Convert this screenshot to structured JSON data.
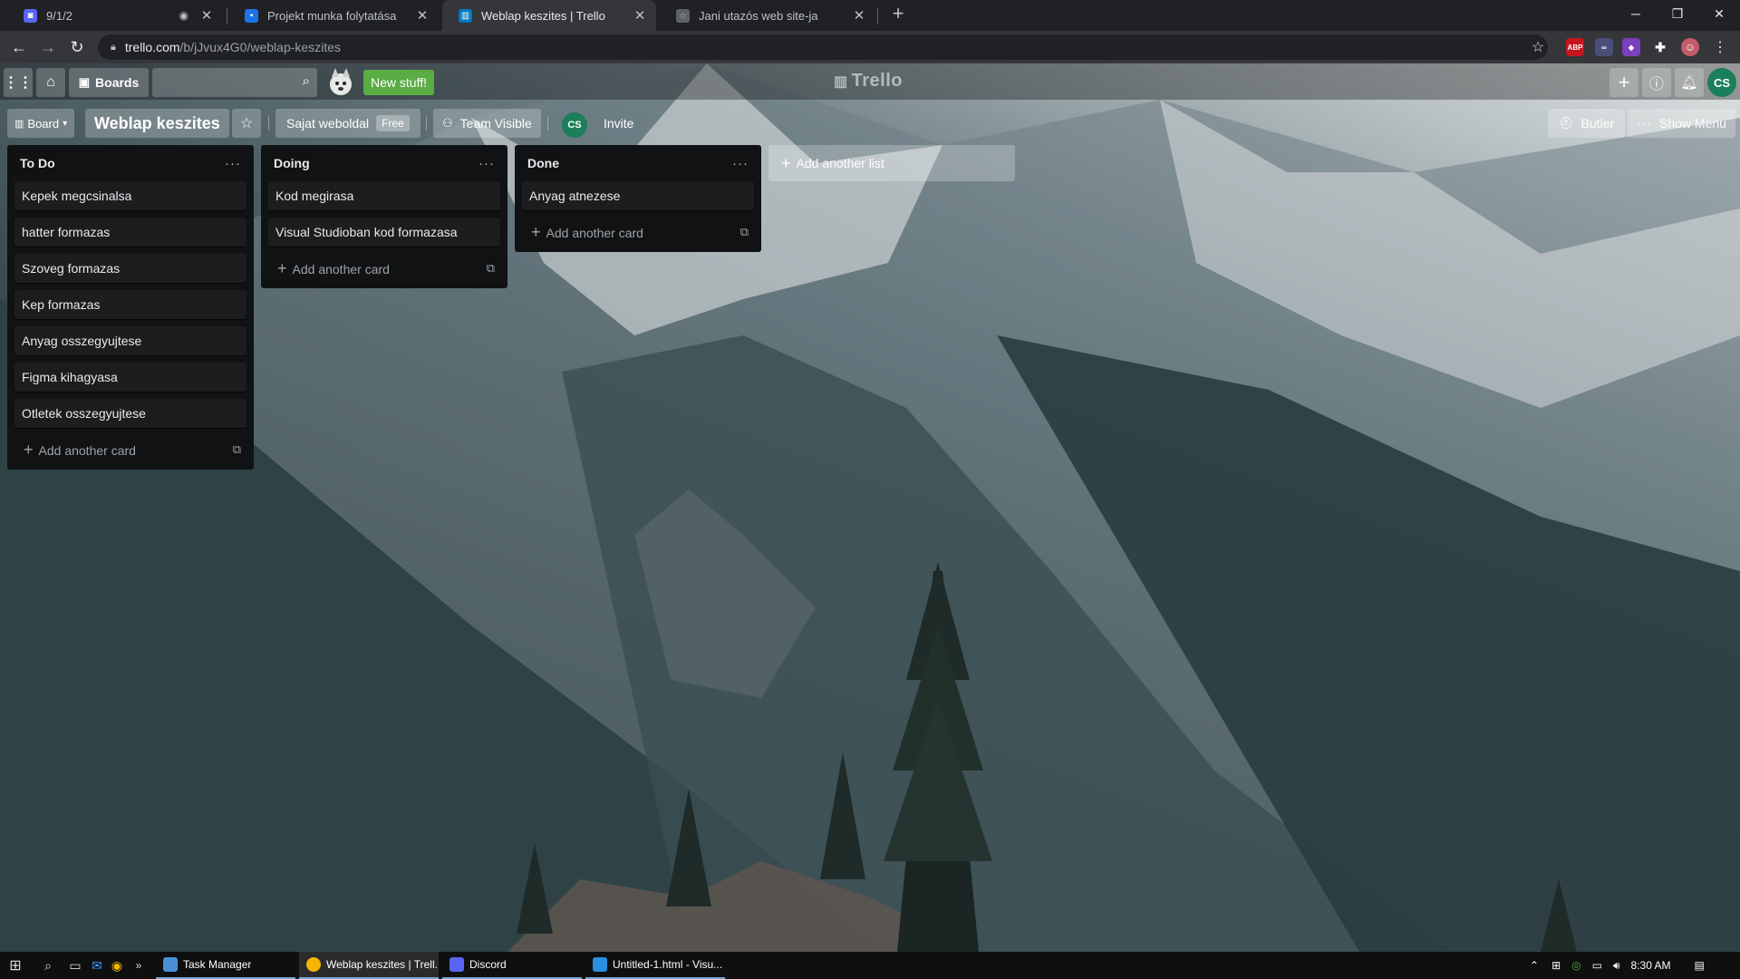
{
  "browser": {
    "tabs": [
      {
        "title": "9/1/2",
        "favicon_color": "#5865f2",
        "favicon": "◙",
        "extra": "◉"
      },
      {
        "title": "Projekt munka folytatása",
        "favicon_color": "#1a73e8",
        "favicon": "▪"
      },
      {
        "title": "Weblap keszites | Trello",
        "favicon_color": "#0079bf",
        "favicon": "▥"
      },
      {
        "title": "Jani utazós web site-ja",
        "favicon_color": "#5f6368",
        "favicon": "◌"
      }
    ],
    "close_glyph": "✕",
    "new_tab": "+",
    "window_controls": {
      "minimize": "─",
      "maximize": "❐",
      "close": "✕"
    },
    "url_host": "trello.com",
    "url_path": "/b/jJvux4G0/weblap-keszites",
    "extensions": [
      {
        "label": "ABP",
        "color": "#c4161c"
      },
      {
        "label": "∞",
        "color": "#4a4f7a"
      },
      {
        "label": "◆",
        "color": "#7b3fbf"
      },
      {
        "label": "✚",
        "color": "#5f6368"
      },
      {
        "label": "☺",
        "color": "#c45b6b"
      }
    ]
  },
  "trello": {
    "header": {
      "boards_label": "Boards",
      "new_stuff_label": "New stuff!",
      "logo": "Trello",
      "user_initials": "CS"
    },
    "board": {
      "view_label": "Board",
      "title": "Weblap keszites",
      "workspace": "Sajat weboldal",
      "workspace_badge": "Free",
      "visibility": "Team Visible",
      "member_initials": "CS",
      "invite_label": "Invite",
      "butler_label": "Butler",
      "menu_label": "Show Menu"
    },
    "lists": [
      {
        "name": "To Do",
        "cards": [
          "Kepek megcsinalsa",
          "hatter formazas",
          "Szoveg formazas",
          "Kep formazas",
          "Anyag osszegyujtese",
          "Figma kihagyasa",
          "Otletek osszegyujtese"
        ],
        "add_card": "Add another card"
      },
      {
        "name": "Doing",
        "cards": [
          "Kod megirasa",
          "Visual Studioban kod formazasa"
        ],
        "add_card": "Add another card"
      },
      {
        "name": "Done",
        "cards": [
          "Anyag atnezese"
        ],
        "add_card": "Add another card"
      }
    ],
    "add_list_label": "Add another list"
  },
  "taskbar": {
    "apps": [
      {
        "title": "Task Manager",
        "color": "#4a90d9",
        "active": false
      },
      {
        "title": "Weblap keszites | Trell...",
        "color": "#f4b400",
        "active": true
      },
      {
        "title": "Discord",
        "color": "#5865f2",
        "active": false
      },
      {
        "title": "Untitled-1.html - Visu...",
        "color": "#2a8fe0",
        "active": false
      }
    ],
    "time": "8:30 AM"
  }
}
